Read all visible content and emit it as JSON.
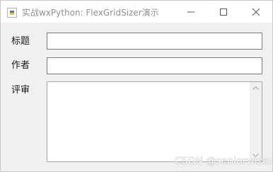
{
  "window": {
    "title": "实战wxPython: FlexGridSizer演示",
    "controls": {
      "minimize": "minimize",
      "maximize": "maximize",
      "close": "close"
    }
  },
  "form": {
    "fields": {
      "title": {
        "label": "标题",
        "value": ""
      },
      "author": {
        "label": "作者",
        "value": ""
      },
      "review": {
        "label": "评审",
        "value": ""
      }
    }
  },
  "watermark": "CSDN @seniorwizard",
  "icons": {
    "app": "python-app-icon",
    "minimize": "minimize-icon",
    "maximize": "maximize-icon",
    "close": "close-icon",
    "scroll_up": "chevron-up-icon",
    "scroll_down": "chevron-down-icon"
  },
  "colors": {
    "client_bg": "#f0f0f0",
    "titlebar_bg": "#ffffff",
    "input_border": "#7a7a7a",
    "title_text": "#909090"
  }
}
